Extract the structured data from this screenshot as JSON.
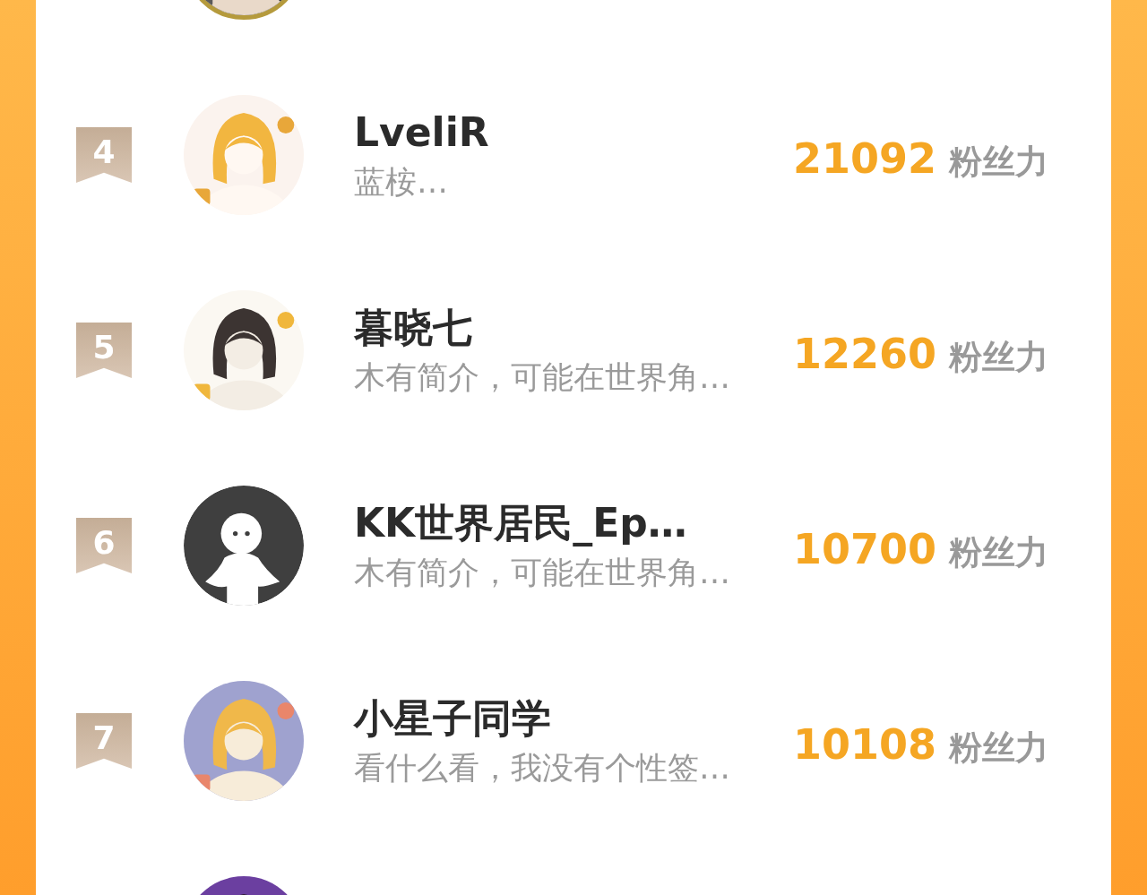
{
  "ranking": [
    {
      "avatar": {
        "kind": "picture",
        "ringed": true
      }
    },
    {
      "rank": "4",
      "avatar": {
        "kind": "picture",
        "ringed": false
      },
      "name": "LveliR",
      "bio": "蓝桉…",
      "score": "21092",
      "unit": "粉丝力"
    },
    {
      "rank": "5",
      "avatar": {
        "kind": "picture",
        "ringed": false
      },
      "name": "暮晓七",
      "bio": "木有简介，可能在世界角…",
      "score": "12260",
      "unit": "粉丝力"
    },
    {
      "rank": "6",
      "avatar": {
        "kind": "default",
        "ringed": false
      },
      "name": "KK世界居民_Ep…",
      "bio": "木有简介，可能在世界角…",
      "score": "10700",
      "unit": "粉丝力"
    },
    {
      "rank": "7",
      "avatar": {
        "kind": "picture",
        "ringed": false
      },
      "name": "小星子同学",
      "bio": "看什么看，我没有个性签…",
      "score": "10108",
      "unit": "粉丝力"
    },
    {
      "avatar": {
        "kind": "picture",
        "ringed": false
      }
    }
  ]
}
